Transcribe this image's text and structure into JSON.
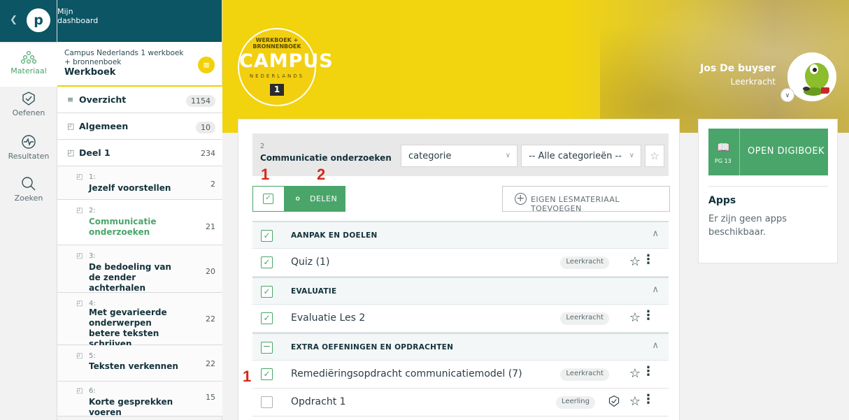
{
  "rail": {
    "back_icon": "chevron-left-icon",
    "logo_letter": "p",
    "items": [
      {
        "label": "Materiaal",
        "icon": "material-icon",
        "active": true
      },
      {
        "label": "Oefenen",
        "icon": "practice-icon"
      },
      {
        "label": "Resultaten",
        "icon": "results-icon"
      },
      {
        "label": "Zoeken",
        "icon": "search-icon"
      }
    ]
  },
  "sidebar": {
    "header": {
      "line1": "Mijn",
      "line2": "dashboard"
    },
    "book": {
      "title": "Campus Nederlands 1 werkboek + bronnenboek",
      "subtitle": "Werkboek",
      "menu_icon": "list-icon"
    },
    "rows": [
      {
        "label": "Overzicht",
        "count": "1154",
        "icon": "list-icon"
      },
      {
        "label": "Algemeen",
        "count": "10",
        "icon": "bookmark-icon"
      },
      {
        "label": "Deel 1",
        "count": "234",
        "icon": "bookmark-icon"
      }
    ],
    "lessons": [
      {
        "num": "1:",
        "label": "Jezelf voorstellen",
        "count": "2"
      },
      {
        "num": "2:",
        "label": "Communicatie onderzoeken",
        "count": "21",
        "active": true
      },
      {
        "num": "3:",
        "label": "De bedoeling van de zender achterhalen",
        "count": "20"
      },
      {
        "num": "4:",
        "label": "Met gevarieerde onderwerpen betere teksten schrijven",
        "count": "22"
      },
      {
        "num": "5:",
        "label": "Teksten verkennen",
        "count": "22"
      },
      {
        "num": "6:",
        "label": "Korte gesprekken voeren",
        "count": "15"
      }
    ]
  },
  "banner": {
    "logo": {
      "top_text": "WERKBOEK + BRONNENBOEK",
      "main_text": "CAMPUS",
      "sub_text": "NEDERLANDS",
      "number": "1"
    },
    "user": {
      "name": "Jos De buyser",
      "role": "Leerkracht"
    }
  },
  "main": {
    "filter": {
      "num": "2",
      "title": "Communicatie onderzoeken",
      "select1": "categorie",
      "select2": "-- Alle categorieën --",
      "star_icon": "star-icon"
    },
    "annotations": {
      "a1": "1",
      "a2": "2",
      "a3": "1"
    },
    "share_label": "DELEN",
    "add_label": "EIGEN LESMATERIAAL TOEVOEGEN",
    "sections": [
      {
        "title": "AANPAK EN DOELEN",
        "items": [
          {
            "label": "Quiz (1)",
            "badge": "Leerkracht",
            "checked": true
          }
        ]
      },
      {
        "title": "EVALUATIE",
        "items": [
          {
            "label": "Evaluatie Les 2",
            "badge": "Leerkracht",
            "checked": true
          }
        ]
      },
      {
        "title": "EXTRA OEFENINGEN EN OPDRACHTEN",
        "partial": true,
        "items": [
          {
            "label": "Remediëringsopdracht communicatiemodel (7)",
            "badge": "Leerkracht",
            "checked": true
          },
          {
            "label": "Opdracht 1",
            "badge": "Leerling",
            "checked": false,
            "practice": true
          }
        ]
      }
    ]
  },
  "right": {
    "digibook": {
      "label": "OPEN DIGIBOEK",
      "page": "PG 13",
      "icon": "book-icon"
    },
    "apps_title": "Apps",
    "apps_empty": "Er zijn geen apps beschikbaar."
  },
  "colors": {
    "brand_teal": "#0b5564",
    "accent_green": "#4aa56a",
    "banner_yellow": "#f1d30e",
    "annotation_red": "#d7281d"
  }
}
